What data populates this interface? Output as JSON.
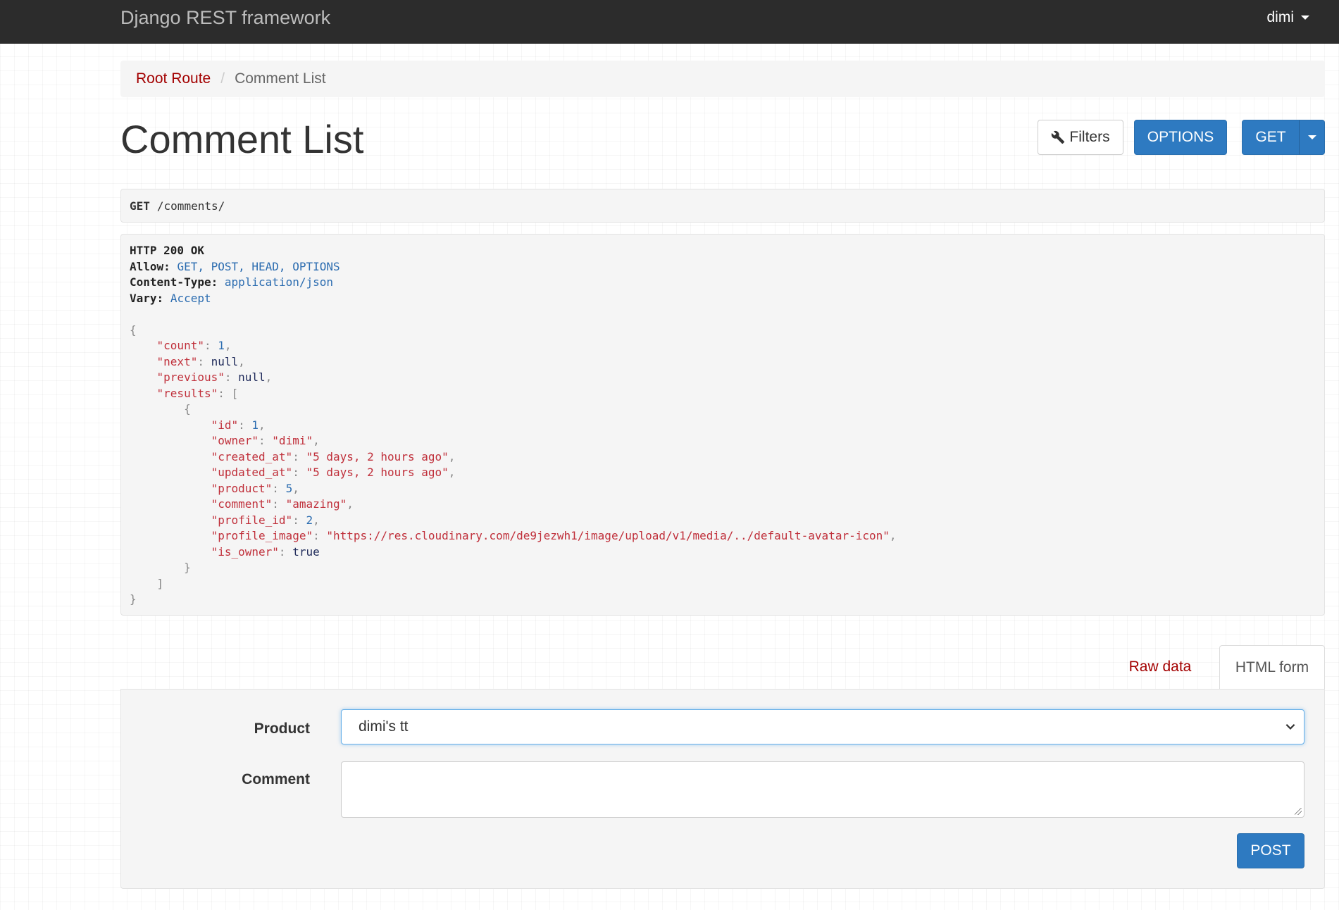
{
  "navbar": {
    "brand": "Django REST framework",
    "user": "dimi"
  },
  "breadcrumb": {
    "root_label": "Root Route",
    "current_label": "Comment List",
    "separator": "/"
  },
  "page": {
    "title": "Comment List"
  },
  "toolbar": {
    "filters_label": "Filters",
    "options_label": "OPTIONS",
    "get_label": "GET"
  },
  "request": {
    "method": "GET",
    "path": "/comments/"
  },
  "response": {
    "status_line": "HTTP 200 OK",
    "headers": [
      {
        "key": "Allow:",
        "value": "GET, POST, HEAD, OPTIONS"
      },
      {
        "key": "Content-Type:",
        "value": "application/json"
      },
      {
        "key": "Vary:",
        "value": "Accept"
      }
    ],
    "body": {
      "count": "1",
      "next": "null",
      "previous": "null",
      "result": {
        "id": "1",
        "owner": "\"dimi\"",
        "created_at": "\"5 days, 2 hours ago\"",
        "updated_at": "\"5 days, 2 hours ago\"",
        "product": "5",
        "comment": "\"amazing\"",
        "profile_id": "2",
        "profile_image": "\"https://res.cloudinary.com/de9jezwh1/image/upload/v1/media/../default-avatar-icon\"",
        "is_owner": "true"
      }
    }
  },
  "tabs": {
    "raw_label": "Raw data",
    "html_label": "HTML form"
  },
  "form": {
    "product_label": "Product",
    "product_value": "dimi's tt",
    "comment_label": "Comment",
    "comment_value": "",
    "submit_label": "POST"
  },
  "colors": {
    "navbar_bg": "#2c2c2c",
    "primary_button": "#2e7ac1",
    "link_red": "#a30000",
    "json_key": "#c0303b",
    "json_number": "#2b6cb0"
  }
}
